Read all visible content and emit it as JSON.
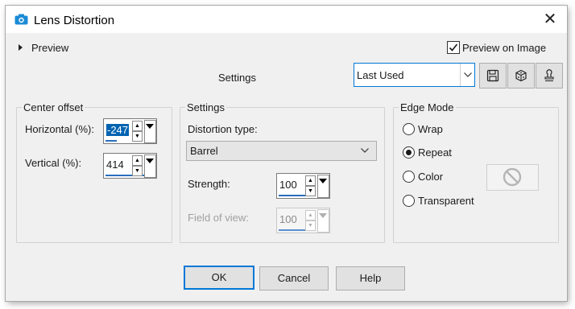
{
  "window": {
    "title": "Lens Distortion"
  },
  "header": {
    "preview_label": "Preview",
    "preview_on_image_label": "Preview on Image",
    "preview_on_image_checked": true,
    "settings_label": "Settings",
    "preset_value": "Last Used"
  },
  "center_offset": {
    "group_label": "Center offset",
    "horizontal_label": "Horizontal (%):",
    "horizontal_value": "-247",
    "vertical_label": "Vertical (%):",
    "vertical_value": "414"
  },
  "settings": {
    "group_label": "Settings",
    "distortion_type_label": "Distortion type:",
    "distortion_type_value": "Barrel",
    "strength_label": "Strength:",
    "strength_value": "100",
    "field_of_view_label": "Field of view:",
    "field_of_view_value": "100"
  },
  "edge_mode": {
    "group_label": "Edge Mode",
    "options": [
      "Wrap",
      "Repeat",
      "Color",
      "Transparent"
    ],
    "selected": "Repeat"
  },
  "buttons": {
    "ok": "OK",
    "cancel": "Cancel",
    "help": "Help"
  },
  "colors": {
    "accent": "#0078d7",
    "selection": "#0063b1",
    "disabled_text": "#a0a0a0"
  }
}
